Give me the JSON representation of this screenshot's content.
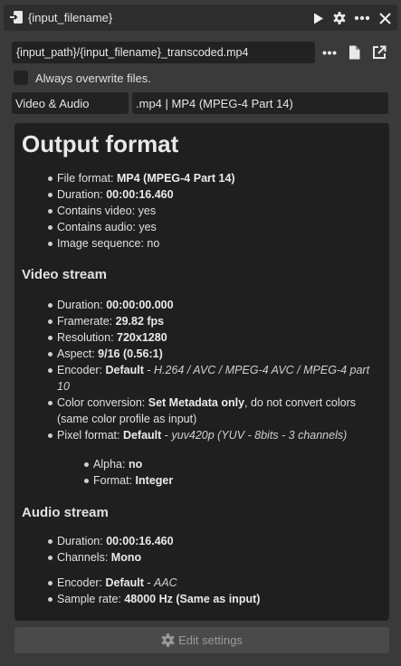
{
  "window": {
    "title": "{input_filename}"
  },
  "output": {
    "path": "{input_path}/{input_filename}_transcoded.mp4",
    "overwrite_label": "Always overwrite files.",
    "preset": "Video & Audio",
    "container": ".mp4 | MP4 (MPEG-4 Part 14)"
  },
  "output_format": {
    "title": "Output format",
    "file_format_label": "File format:",
    "file_format": "MP4 (MPEG-4 Part 14)",
    "duration_label": "Duration:",
    "duration": "00:00:16.460",
    "contains_video": "Contains video: yes",
    "contains_audio": "Contains audio: yes",
    "image_sequence": "Image sequence: no"
  },
  "video_stream": {
    "title": "Video stream",
    "duration_label": "Duration:",
    "duration": "00:00:00.000",
    "framerate_label": "Framerate:",
    "framerate": "29.82 fps",
    "resolution_label": "Resolution:",
    "resolution": "720x1280",
    "aspect_label": "Aspect:",
    "aspect": "9/16 (0.56:1)",
    "encoder_label": "Encoder:",
    "encoder": "Default",
    "encoder_sep": " - ",
    "encoder_detail": "H.264 / AVC / MPEG-4 AVC / MPEG-4 part 10",
    "color_label": "Color conversion:",
    "color": "Set Metadata only",
    "color_detail": ", do not convert colors (same color profile as input)",
    "pixel_label": "Pixel format:",
    "pixel": "Default",
    "pixel_sep": " - ",
    "pixel_detail": "yuv420p (YUV - 8bits - 3 channels)",
    "alpha_label": "Alpha:",
    "alpha": "no",
    "format_label": "Format:",
    "format": "Integer"
  },
  "audio_stream": {
    "title": "Audio stream",
    "duration_label": "Duration:",
    "duration": "00:00:16.460",
    "channels_label": "Channels:",
    "channels": "Mono",
    "encoder_label": "Encoder:",
    "encoder": "Default",
    "encoder_sep": " - ",
    "encoder_detail": "AAC",
    "sample_rate_label": "Sample rate:",
    "sample_rate": "48000 Hz (Same as input)"
  },
  "actions": {
    "edit_settings": "Edit settings"
  },
  "icons": {
    "node": "input-node-icon",
    "play": "play-icon",
    "gear": "gear-icon",
    "more": "more-icon",
    "close": "close-icon",
    "file": "file-icon",
    "open_external": "open-external-icon"
  }
}
